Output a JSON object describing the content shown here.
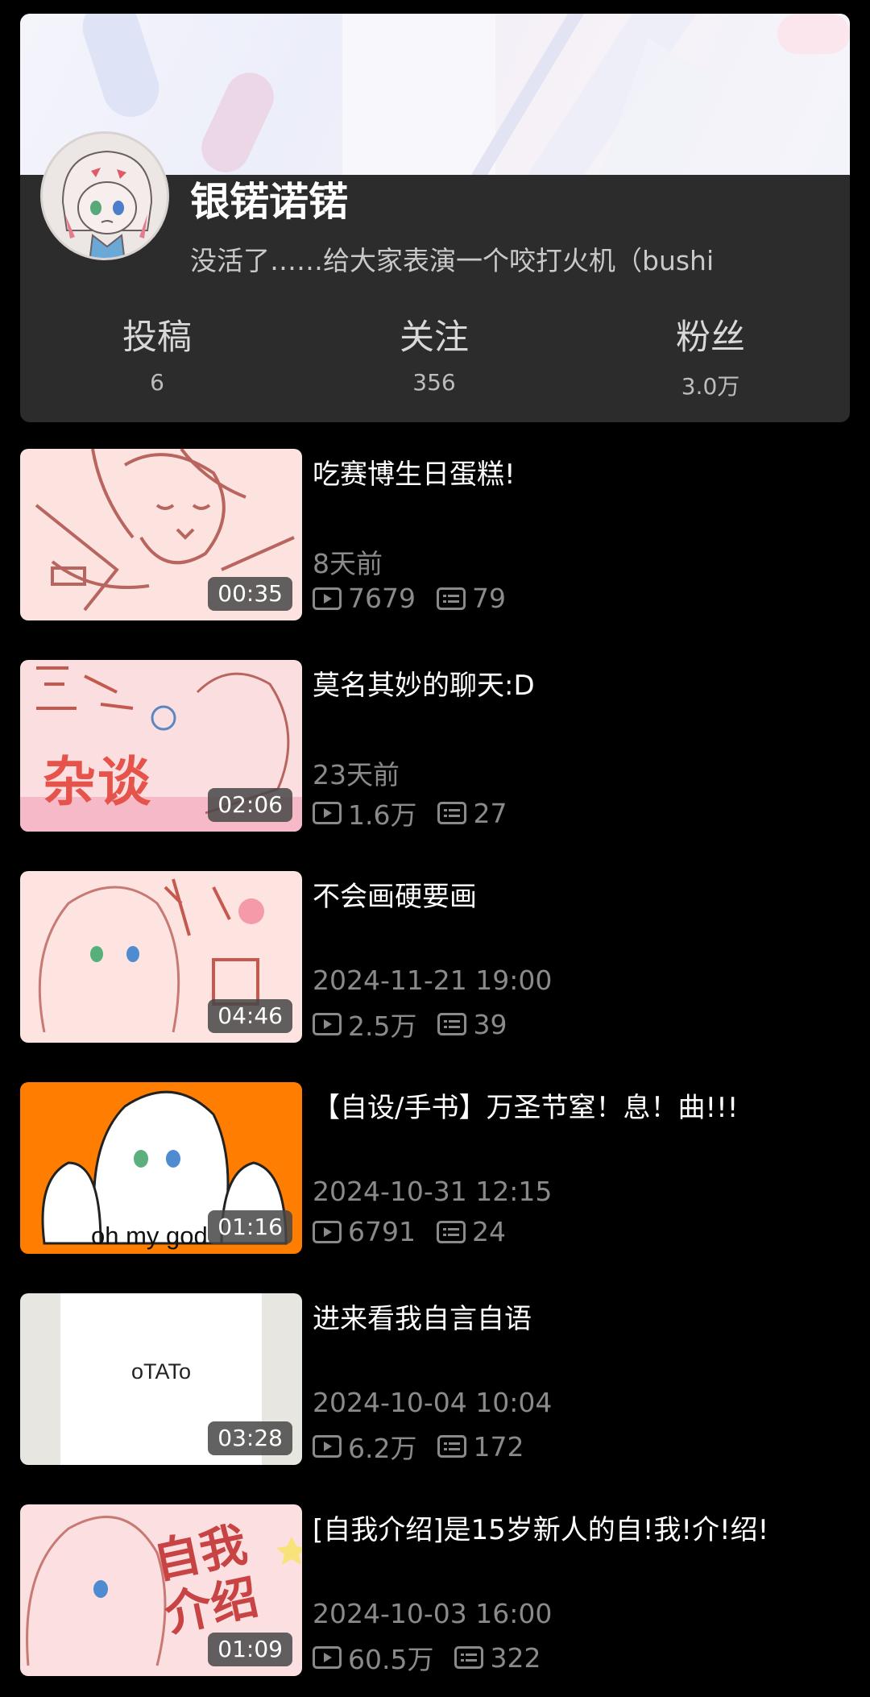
{
  "profile": {
    "name": "银锘诺锘",
    "bio": "没活了……给大家表演一个咬打火机（bushi",
    "stats": [
      {
        "label": "投稿",
        "value": "6"
      },
      {
        "label": "关注",
        "value": "356"
      },
      {
        "label": "粉丝",
        "value": "3.0万"
      }
    ]
  },
  "videos": [
    {
      "title": "吃赛博生日蛋糕!",
      "date": "8天前",
      "views": "7679",
      "comments": "79",
      "duration": "00:35",
      "thumb_color": "#fde3df"
    },
    {
      "title": "莫名其妙的聊天:D",
      "date": "23天前",
      "views": "1.6万",
      "comments": "27",
      "duration": "02:06",
      "thumb_color": "#fbdfe0",
      "thumb_text": "杂谈"
    },
    {
      "title": "不会画硬要画",
      "date": "2024-11-21 19:00",
      "views": "2.5万",
      "comments": "39",
      "duration": "04:46",
      "thumb_color": "#fde4e0"
    },
    {
      "title": "【自设/手书】万圣节窒！息！曲!!!",
      "date": "2024-10-31 12:15",
      "views": "6791",
      "comments": "24",
      "duration": "01:16",
      "thumb_color": "#ff7d00",
      "thumb_text": "oh my god"
    },
    {
      "title": "进来看我自言自语",
      "date": "2024-10-04 10:04",
      "views": "6.2万",
      "comments": "172",
      "duration": "03:28",
      "thumb_color": "#e8e6e1",
      "thumb_text": "oTATo"
    },
    {
      "title": "[自我介绍]是15岁新人的自!我!介!绍!",
      "date": "2024-10-03 16:00",
      "views": "60.5万",
      "comments": "322",
      "duration": "01:09",
      "thumb_color": "#fcdfe0",
      "thumb_text": "自我介绍"
    }
  ],
  "icons": {
    "play": "play-count-icon",
    "comment": "comment-count-icon"
  },
  "colors": {
    "card_bg": "#2c2c2c",
    "secondary_text": "#8a8a8a",
    "page_bg": "#000000"
  }
}
